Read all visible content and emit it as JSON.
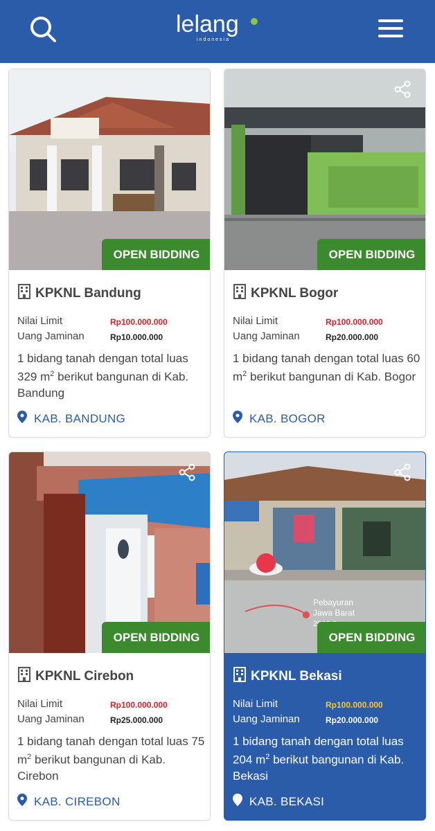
{
  "header": {
    "logo_text": "lelang",
    "logo_subtext": "indonesia",
    "search_icon": "search-icon",
    "menu_icon": "hamburger-menu-icon",
    "background_color": "#2a5caa"
  },
  "labels": {
    "nilai_limit": "Nilai Limit",
    "uang_jaminan": "Uang Jaminan",
    "badge": "OPEN BIDDING"
  },
  "colors": {
    "badge": "#3c8a2e",
    "limit_value": "#d0232a",
    "active_card": "#2a5caa",
    "active_limit_value": "#f7c83d"
  },
  "listings": [
    {
      "title": "KPKNL Bandung",
      "nilai_limit": "Rp100.000.000",
      "uang_jaminan": "Rp10.000.000",
      "desc_pre": "1 bidang tanah dengan total luas 329 m",
      "desc_sup": "2",
      "desc_post": " berikut bangunan di Kab. Bandung",
      "location": "KAB. BANDUNG",
      "has_share": false,
      "active": false
    },
    {
      "title": "KPKNL Bogor",
      "nilai_limit": "Rp100.000.000",
      "uang_jaminan": "Rp20.000.000",
      "desc_pre": "1 bidang tanah dengan total luas 60 m",
      "desc_sup": "2",
      "desc_post": " berikut bangunan di Kab. Bogor",
      "location": "KAB. BOGOR",
      "has_share": true,
      "active": false
    },
    {
      "title": "KPKNL Cirebon",
      "nilai_limit": "Rp100.000.000",
      "uang_jaminan": "Rp25.000.000",
      "desc_pre": "1 bidang tanah dengan total luas 75 m",
      "desc_sup": "2",
      "desc_post": " berikut bangunan di Kab. Cirebon",
      "location": "KAB. CIREBON",
      "has_share": true,
      "active": false
    },
    {
      "title": "KPKNL Bekasi",
      "nilai_limit": "Rp100.000.000",
      "uang_jaminan": "Rp20.000.000",
      "desc_pre": "1 bidang tanah dengan total luas 204 m",
      "desc_sup": "2",
      "desc_post": " berikut bangunan di Kab. Bekasi",
      "location": "KAB. BEKASI",
      "has_share": true,
      "active": true,
      "photo_overlay_line1": "Pebayuran",
      "photo_overlay_line2": "Jawa Barat",
      "photo_overlay_date": "2023-0"
    }
  ]
}
